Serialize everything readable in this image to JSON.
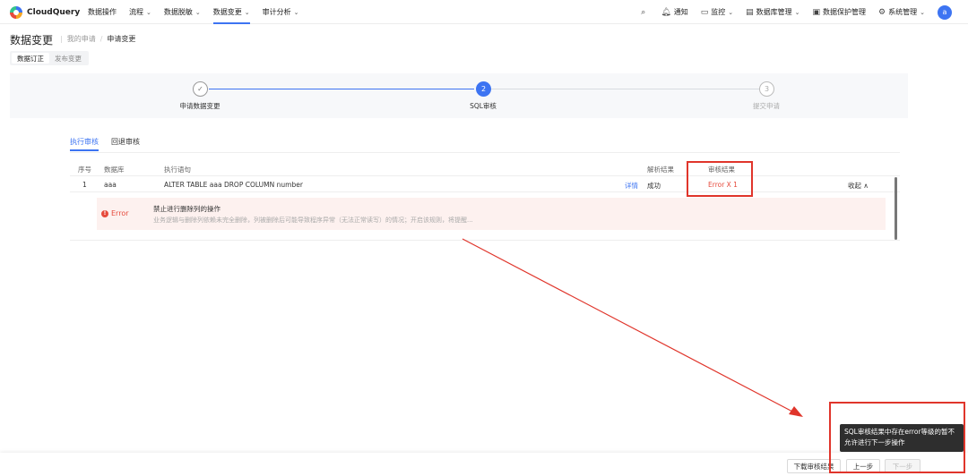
{
  "nav": {
    "logo": "CloudQuery",
    "items": [
      {
        "label": "数据操作",
        "chevron": false
      },
      {
        "label": "流程",
        "chevron": true
      },
      {
        "label": "数据脱敏",
        "chevron": true
      },
      {
        "label": "数据变更",
        "chevron": true
      },
      {
        "label": "审计分析",
        "chevron": true
      }
    ],
    "right": {
      "notify": "通知",
      "monitor": "监控",
      "db_manage": "数据库管理",
      "data_protect": "数据保护管理",
      "system_manage": "系统管理",
      "avatar": "a"
    }
  },
  "header": {
    "title": "数据变更",
    "breadcrumb_1": "我的申请",
    "breadcrumb_2": "申请变更",
    "subtabs": [
      "数据订正",
      "发布变更"
    ]
  },
  "steps": [
    {
      "label": "申请数据变更",
      "symbol": "✓",
      "state": "done"
    },
    {
      "label": "SQL审核",
      "symbol": "2",
      "state": "active"
    },
    {
      "label": "提交申请",
      "symbol": "3",
      "state": "todo"
    }
  ],
  "result_tabs": [
    "执行审核",
    "回退审核"
  ],
  "table": {
    "headers": [
      "序号",
      "数据库",
      "执行语句",
      "解析结果",
      "审核结果"
    ],
    "row": {
      "index": "1",
      "database": "aaa",
      "statement": "ALTER TABLE aaa DROP COLUMN number",
      "detail": "详情",
      "parse_result": "成功",
      "audit_result": "Error X 1",
      "collapse": "收起 ∧"
    },
    "expanded": {
      "level": "Error",
      "title": "禁止进行删除列的操作",
      "description": "业务逻辑与删除列依赖未完全删除，列被删除后可能导致程序异常（无法正常读写）的情况；开启该规则，将提醒..."
    }
  },
  "tooltip": "SQL审核结果中存在error等级的暂不允许进行下一步操作",
  "buttons": {
    "download": "下载审核结果",
    "prev": "上一步",
    "next": "下一步"
  },
  "colors": {
    "accent": "#3d74f2",
    "error": "#e64a3c",
    "annotation": "#e0352b"
  }
}
